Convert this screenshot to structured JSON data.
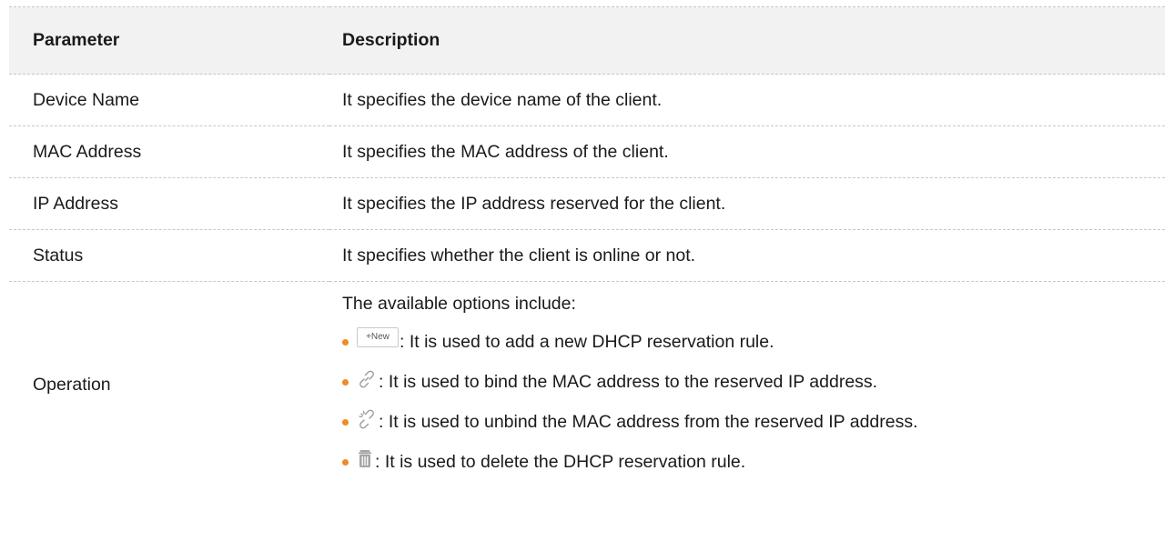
{
  "table": {
    "headers": {
      "parameter": "Parameter",
      "description": "Description"
    },
    "rows": [
      {
        "parameter": "Device Name",
        "description": "It specifies the device name of the client."
      },
      {
        "parameter": "MAC Address",
        "description": "It specifies the MAC address of the client."
      },
      {
        "parameter": "IP Address",
        "description": "It specifies the IP address reserved for the client."
      },
      {
        "parameter": "Status",
        "description": "It specifies whether the client is online or not."
      }
    ],
    "operation": {
      "parameter": "Operation",
      "intro": "The available options include:",
      "items": [
        {
          "icon": "new-button-icon",
          "button_label": "+New",
          "text": ": It is used to add a new DHCP reservation rule."
        },
        {
          "icon": "link-icon",
          "text": ": It is used to bind the MAC address to the reserved IP address."
        },
        {
          "icon": "unlink-icon",
          "text": ": It is used to unbind the MAC address from the reserved IP address."
        },
        {
          "icon": "trash-icon",
          "text": ": It is used to delete the DHCP reservation rule."
        }
      ]
    }
  },
  "colors": {
    "bullet": "#f08a24",
    "header_bg": "#f2f2f2",
    "divider": "#c8c8c8",
    "icon_gray": "#9a9a9a"
  }
}
